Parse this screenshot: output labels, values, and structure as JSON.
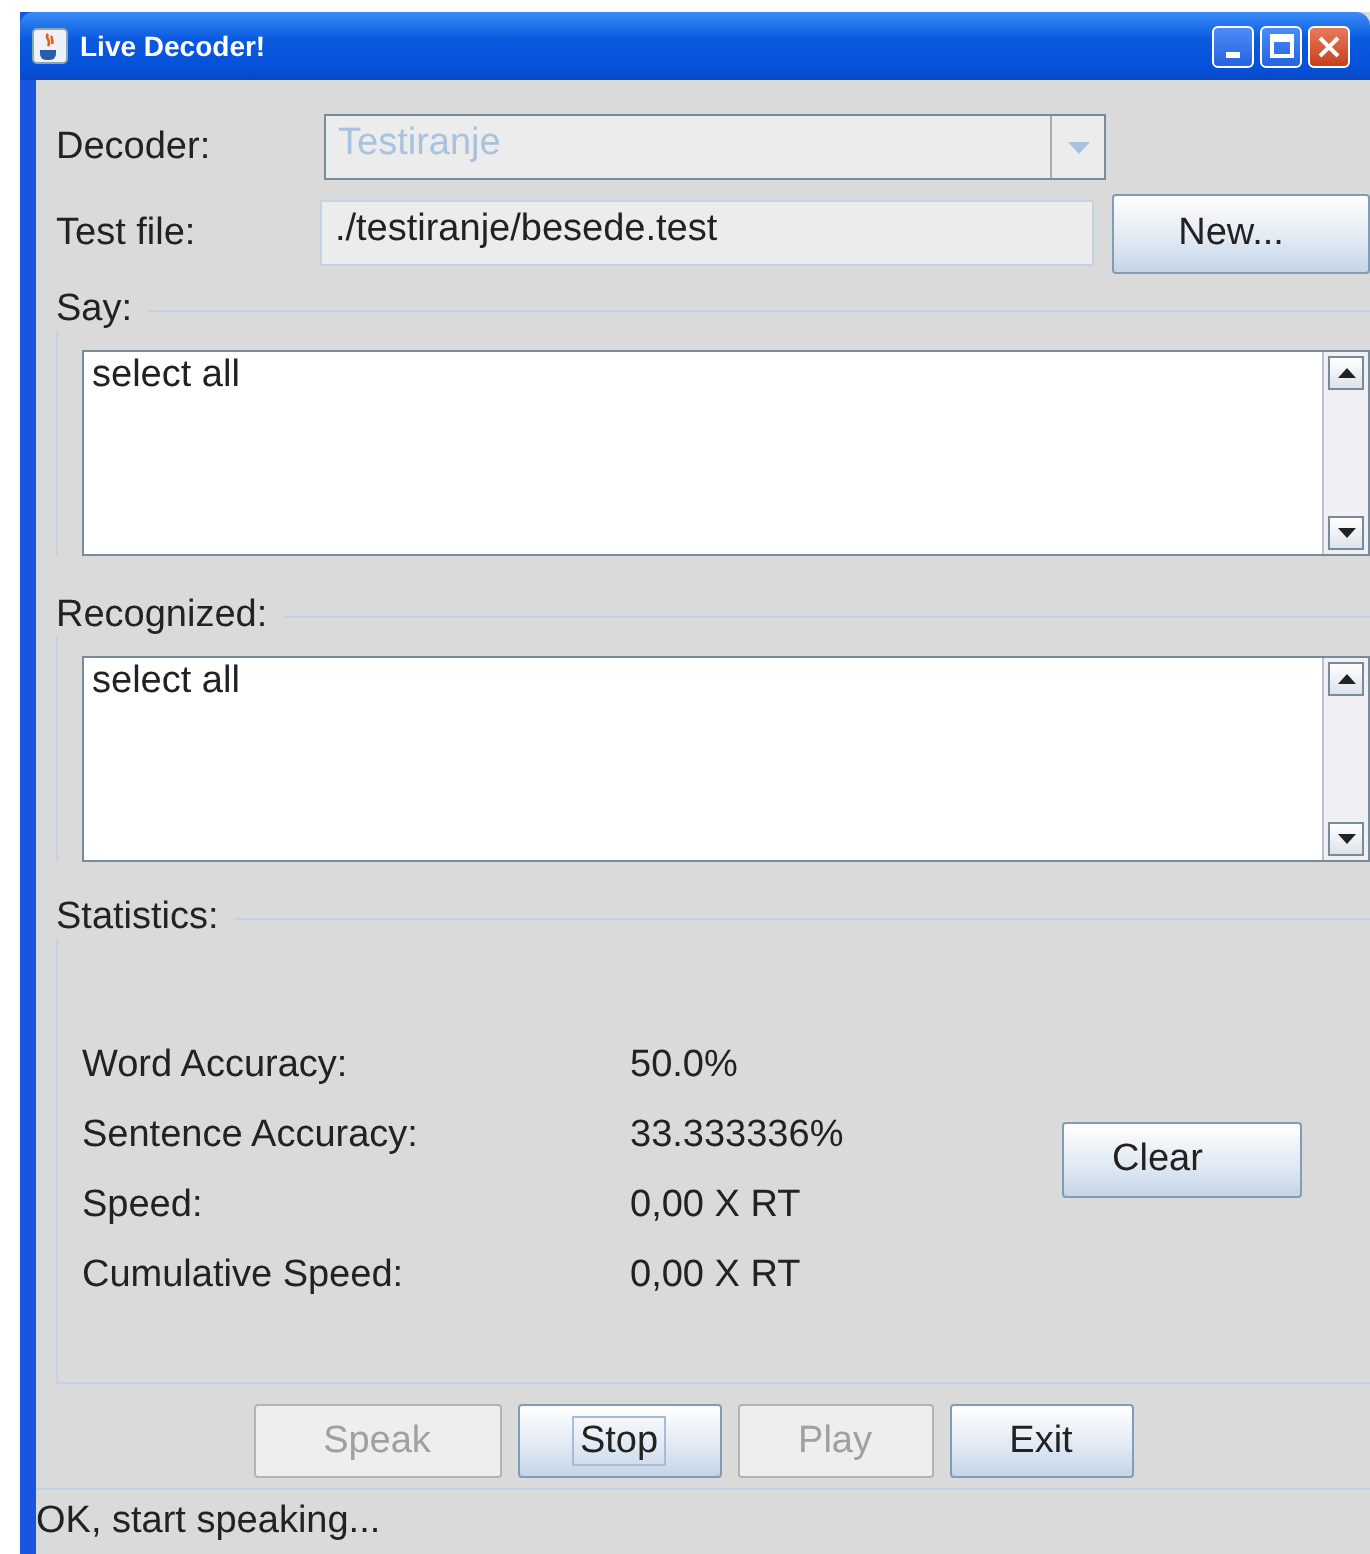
{
  "window": {
    "title": "Live Decoder!"
  },
  "decoder": {
    "label": "Decoder:",
    "value": "Testiranje",
    "disabled": true
  },
  "test_file": {
    "label": "Test file:",
    "value": "./testiranje/besede.test",
    "button": "New..."
  },
  "say": {
    "title": "Say:",
    "text": "select all"
  },
  "recognized": {
    "title": "Recognized:",
    "text": "select all"
  },
  "statistics": {
    "title": "Statistics:",
    "rows": [
      {
        "label": "Word Accuracy:",
        "value": "50.0%"
      },
      {
        "label": "Sentence Accuracy:",
        "value": "33.333336%"
      },
      {
        "label": "Speed:",
        "value": "0,00 X RT"
      },
      {
        "label": "Cumulative Speed:",
        "value": "0,00 X RT"
      }
    ],
    "clear_button": "Clear"
  },
  "buttons": [
    {
      "label": "Speak",
      "disabled": true,
      "focused": false
    },
    {
      "label": "Stop",
      "disabled": false,
      "focused": true
    },
    {
      "label": "Play",
      "disabled": true,
      "focused": false
    },
    {
      "label": "Exit",
      "disabled": false,
      "focused": false
    }
  ],
  "status_bar": "OK, start speaking..."
}
